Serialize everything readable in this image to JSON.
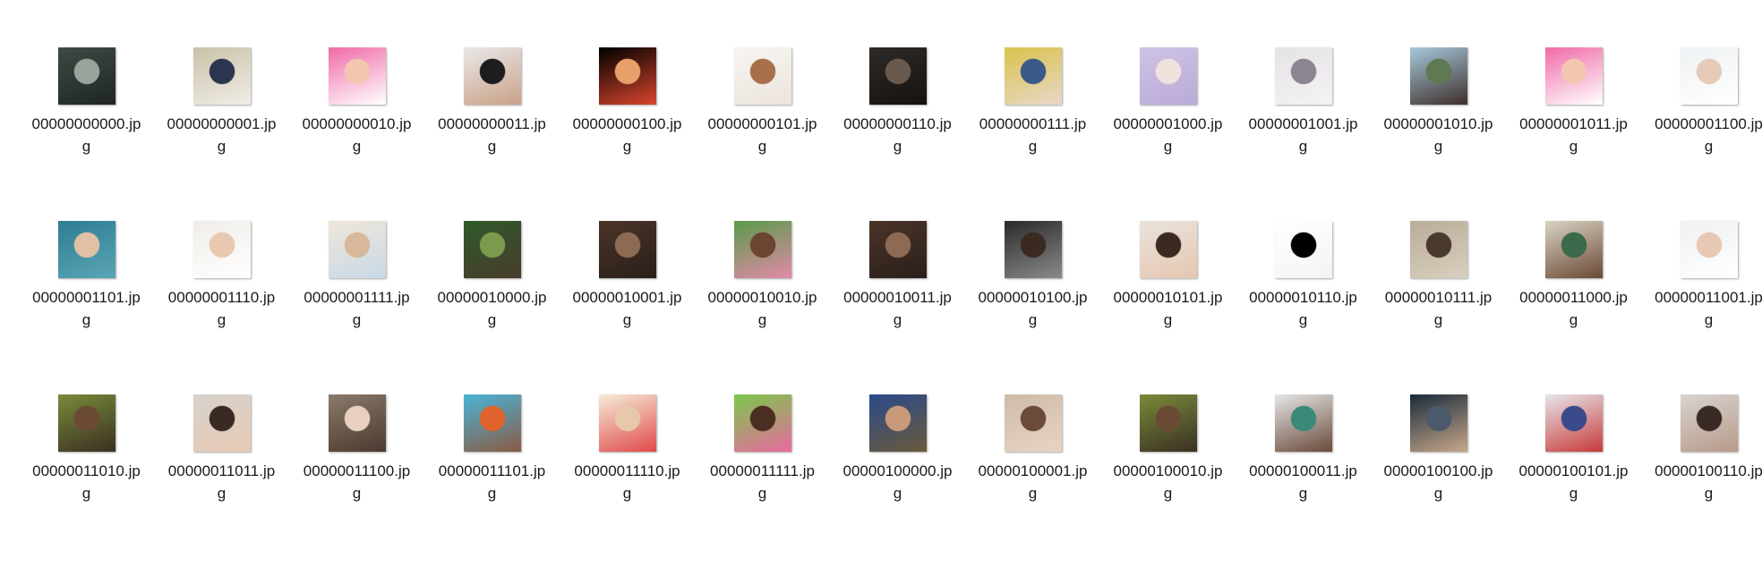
{
  "files": [
    {
      "name": "00000000000.jpg",
      "icon": "street-photo-icon",
      "colors": [
        "#3f4a44",
        "#9aa39c",
        "#1f2623"
      ]
    },
    {
      "name": "00000000001.jpg",
      "icon": "child-photo-icon",
      "colors": [
        "#c9c2a9",
        "#2b3550",
        "#f1ede6"
      ]
    },
    {
      "name": "00000000010.jpg",
      "icon": "child-photo-icon",
      "colors": [
        "#f06aa7",
        "#f3c6b2",
        "#ffffff"
      ]
    },
    {
      "name": "00000000011.jpg",
      "icon": "man-photo-icon",
      "colors": [
        "#e9e9e9",
        "#1d1d1d",
        "#c9a187"
      ]
    },
    {
      "name": "00000000100.jpg",
      "icon": "cartoon-boy-icon",
      "colors": [
        "#000000",
        "#e8a06a",
        "#d9452c"
      ]
    },
    {
      "name": "00000000101.jpg",
      "icon": "baby-photo-icon",
      "colors": [
        "#f7f5f2",
        "#a8704a",
        "#ebe4dc"
      ]
    },
    {
      "name": "00000000110.jpg",
      "icon": "men-photo-icon",
      "colors": [
        "#2e2a28",
        "#6a5a4e",
        "#15120f"
      ]
    },
    {
      "name": "00000000111.jpg",
      "icon": "child-photo-icon",
      "colors": [
        "#d9c24c",
        "#3b5a8a",
        "#e8d8c8"
      ]
    },
    {
      "name": "00000001000.jpg",
      "icon": "baby-photo-icon",
      "colors": [
        "#cfc2e6",
        "#f0e2dc",
        "#b9abd6"
      ]
    },
    {
      "name": "00000001001.jpg",
      "icon": "sketch-portrait-icon",
      "colors": [
        "#e6e3e6",
        "#8a8590",
        "#f4f2f4"
      ]
    },
    {
      "name": "00000001010.jpg",
      "icon": "poster-photo-icon",
      "colors": [
        "#a8c8dc",
        "#5f7a52",
        "#3d2f2a"
      ]
    },
    {
      "name": "00000001011.jpg",
      "icon": "child-photo-icon",
      "colors": [
        "#f06aa7",
        "#f3c6b2",
        "#ffffff"
      ]
    },
    {
      "name": "00000001100.jpg",
      "icon": "baby-photo-icon",
      "colors": [
        "#eef1f3",
        "#e6cbb8",
        "#ffffff"
      ]
    },
    {
      "name": "00000001101.jpg",
      "icon": "movie-poster-icon",
      "colors": [
        "#2f7d92",
        "#e2c0a6",
        "#5aa5b6"
      ]
    },
    {
      "name": "00000001110.jpg",
      "icon": "baby-photo-icon",
      "colors": [
        "#f0ede8",
        "#e7c9b2",
        "#ffffff"
      ]
    },
    {
      "name": "00000001111.jpg",
      "icon": "baby-photo-icon",
      "colors": [
        "#efe6da",
        "#d8b89a",
        "#c9d9e6"
      ]
    },
    {
      "name": "00000010000.jpg",
      "icon": "people-photo-icon",
      "colors": [
        "#2e5a2a",
        "#7c9a4c",
        "#4a3b2c"
      ]
    },
    {
      "name": "00000010001.jpg",
      "icon": "crowd-photo-icon",
      "colors": [
        "#4a3428",
        "#8c6a54",
        "#2a1f1a"
      ]
    },
    {
      "name": "00000010010.jpg",
      "icon": "girls-photo-icon",
      "colors": [
        "#5a9a4a",
        "#6b4432",
        "#e28aa8"
      ]
    },
    {
      "name": "00000010011.jpg",
      "icon": "crowd-photo-icon",
      "colors": [
        "#4a3428",
        "#8c6a54",
        "#2a1f1a"
      ]
    },
    {
      "name": "00000010100.jpg",
      "icon": "man-photo-icon",
      "colors": [
        "#2a2a2a",
        "#3b2a22",
        "#8a8a8a"
      ]
    },
    {
      "name": "00000010101.jpg",
      "icon": "child-photo-icon",
      "colors": [
        "#e9e4dd",
        "#3a2a22",
        "#e6c6b0"
      ]
    },
    {
      "name": "00000010110.jpg",
      "icon": "cartoon-sketch-icon",
      "colors": [
        "#ffffff",
        "#000000",
        "#f4f4f4"
      ]
    },
    {
      "name": "00000010111.jpg",
      "icon": "girl-photo-icon",
      "colors": [
        "#b8ad98",
        "#4a3a2e",
        "#d8cfbe"
      ]
    },
    {
      "name": "00000011000.jpg",
      "icon": "child-photo-icon",
      "colors": [
        "#d9d2c4",
        "#3a6a4a",
        "#6a4a34"
      ]
    },
    {
      "name": "00000011001.jpg",
      "icon": "baby-photo-icon",
      "colors": [
        "#eef0f2",
        "#e8c8b2",
        "#ffffff"
      ]
    },
    {
      "name": "00000011010.jpg",
      "icon": "baby-photo-icon",
      "colors": [
        "#7a8a3a",
        "#6a4a34",
        "#3a3022"
      ]
    },
    {
      "name": "00000011011.jpg",
      "icon": "woman-photo-icon",
      "colors": [
        "#d6d2cc",
        "#3a2a24",
        "#e8c9b4"
      ]
    },
    {
      "name": "00000011100.jpg",
      "icon": "girls-photo-icon",
      "colors": [
        "#8a7a6a",
        "#e8cfc0",
        "#4a3a30"
      ]
    },
    {
      "name": "00000011101.jpg",
      "icon": "woman-photo-icon",
      "colors": [
        "#4ab4d8",
        "#e0632c",
        "#8a5a42"
      ]
    },
    {
      "name": "00000011110.jpg",
      "icon": "baby-photo-icon",
      "colors": [
        "#f6ecd8",
        "#e8c8aa",
        "#e04a4a"
      ]
    },
    {
      "name": "00000011111.jpg",
      "icon": "girl-photo-icon",
      "colors": [
        "#7ac84a",
        "#4a2e22",
        "#e86aa0"
      ]
    },
    {
      "name": "00000100000.jpg",
      "icon": "nun-photo-icon",
      "colors": [
        "#2a4a8a",
        "#c89a7a",
        "#6a5a3a"
      ]
    },
    {
      "name": "00000100001.jpg",
      "icon": "woman-photo-icon",
      "colors": [
        "#cdbba8",
        "#6a4a38",
        "#e8d4c2"
      ]
    },
    {
      "name": "00000100010.jpg",
      "icon": "baby-photo-icon",
      "colors": [
        "#7a8a3a",
        "#6a4a34",
        "#3a3022"
      ]
    },
    {
      "name": "00000100011.jpg",
      "icon": "group-photo-icon",
      "colors": [
        "#e6e6e6",
        "#3a8a7a",
        "#6a4a3a"
      ]
    },
    {
      "name": "00000100100.jpg",
      "icon": "group-photo-icon",
      "colors": [
        "#1a2a3a",
        "#4a5a6a",
        "#c8a88a"
      ]
    },
    {
      "name": "00000100101.jpg",
      "icon": "group-photo-icon",
      "colors": [
        "#e6e6ea",
        "#3a4a8a",
        "#c83a3a"
      ]
    },
    {
      "name": "00000100110.jpg",
      "icon": "child-photo-icon",
      "colors": [
        "#d8d4d0",
        "#3a2a26",
        "#b89a8a"
      ]
    }
  ]
}
